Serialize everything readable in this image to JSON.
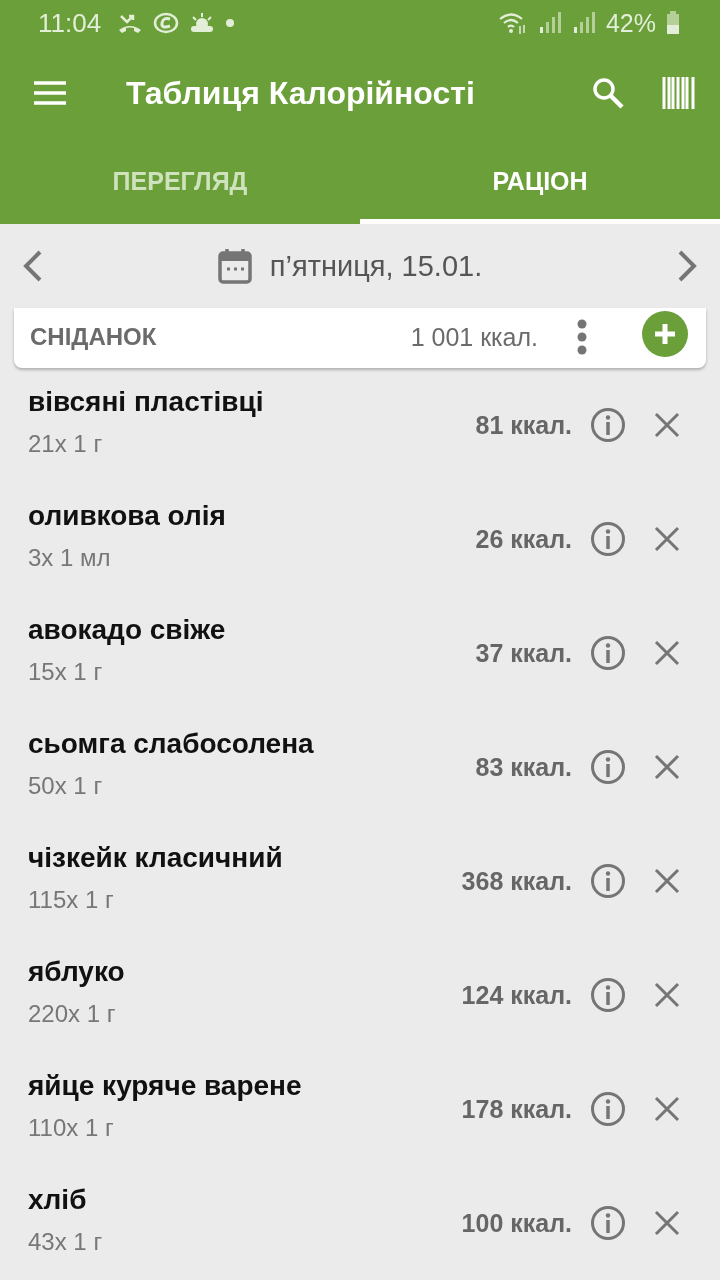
{
  "status_bar": {
    "time": "11:04",
    "battery": "42%"
  },
  "toolbar": {
    "title": "Таблиця Калорійності"
  },
  "tabs": [
    {
      "label": "ПЕРЕГЛЯД",
      "selected": false
    },
    {
      "label": "РАЦІОН",
      "selected": true
    }
  ],
  "date_nav": {
    "date": "п’ятниця, 15.01."
  },
  "meal": {
    "name": "СНІДАНОК",
    "total": "1 001 ккал."
  },
  "items": [
    {
      "name": "вівсяні пластівці",
      "portion": "21x 1 г",
      "calories": "81 ккал."
    },
    {
      "name": "оливкова олія",
      "portion": "3x 1 мл",
      "calories": "26 ккал."
    },
    {
      "name": "авокадо свіже",
      "portion": "15x 1 г",
      "calories": "37 ккал."
    },
    {
      "name": "сьомга слабосолена",
      "portion": "50x 1 г",
      "calories": "83 ккал."
    },
    {
      "name": "чізкейк класичний",
      "portion": "115x 1 г",
      "calories": "368 ккал."
    },
    {
      "name": "яблуко",
      "portion": "220x 1 г",
      "calories": "124 ккал."
    },
    {
      "name": "яйце куряче варене",
      "portion": "110x 1 г",
      "calories": "178 ккал."
    },
    {
      "name": "хліб",
      "portion": "43x 1 г",
      "calories": "100 ккал."
    }
  ]
}
